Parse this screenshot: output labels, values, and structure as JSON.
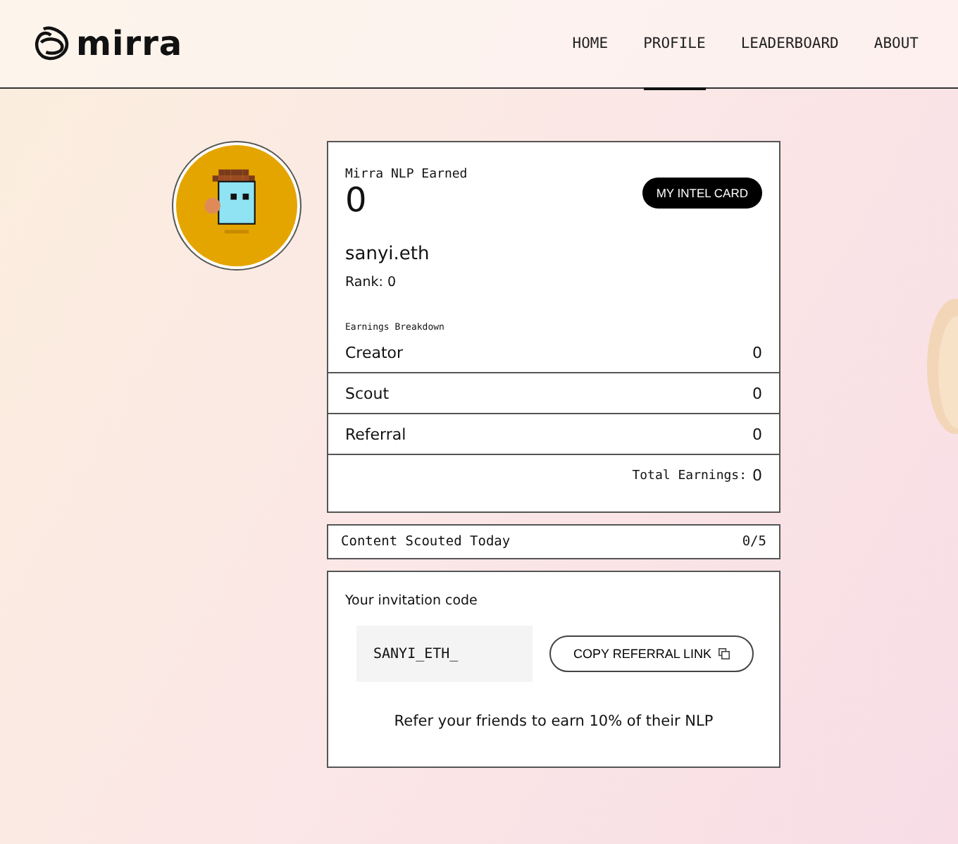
{
  "header": {
    "logo": "mirra",
    "nav": [
      {
        "label": "HOME",
        "selected": false
      },
      {
        "label": "PROFILE",
        "selected": true
      },
      {
        "label": "LEADERBOARD",
        "selected": false
      },
      {
        "label": "ABOUT",
        "selected": false
      }
    ]
  },
  "profile": {
    "earned_label": "Mirra NLP Earned",
    "earned_value": "0",
    "intel_button": "MY INTEL CARD",
    "username": "sanyi.eth",
    "rank": "Rank: 0",
    "breakdown_label": "Earnings Breakdown",
    "breakdown": [
      {
        "name": "Creator",
        "value": "0"
      },
      {
        "name": "Scout",
        "value": "0"
      },
      {
        "name": "Referral",
        "value": "0"
      }
    ],
    "total_label": "Total Earnings:",
    "total_value": "0"
  },
  "scouted": {
    "label": "Content Scouted Today",
    "value": "0/5"
  },
  "invitation": {
    "title": "Your invitation code",
    "code": "SANYI_ETH_",
    "copy_button": "COPY REFERRAL LINK",
    "note": "Refer your friends to earn 10% of their NLP"
  }
}
